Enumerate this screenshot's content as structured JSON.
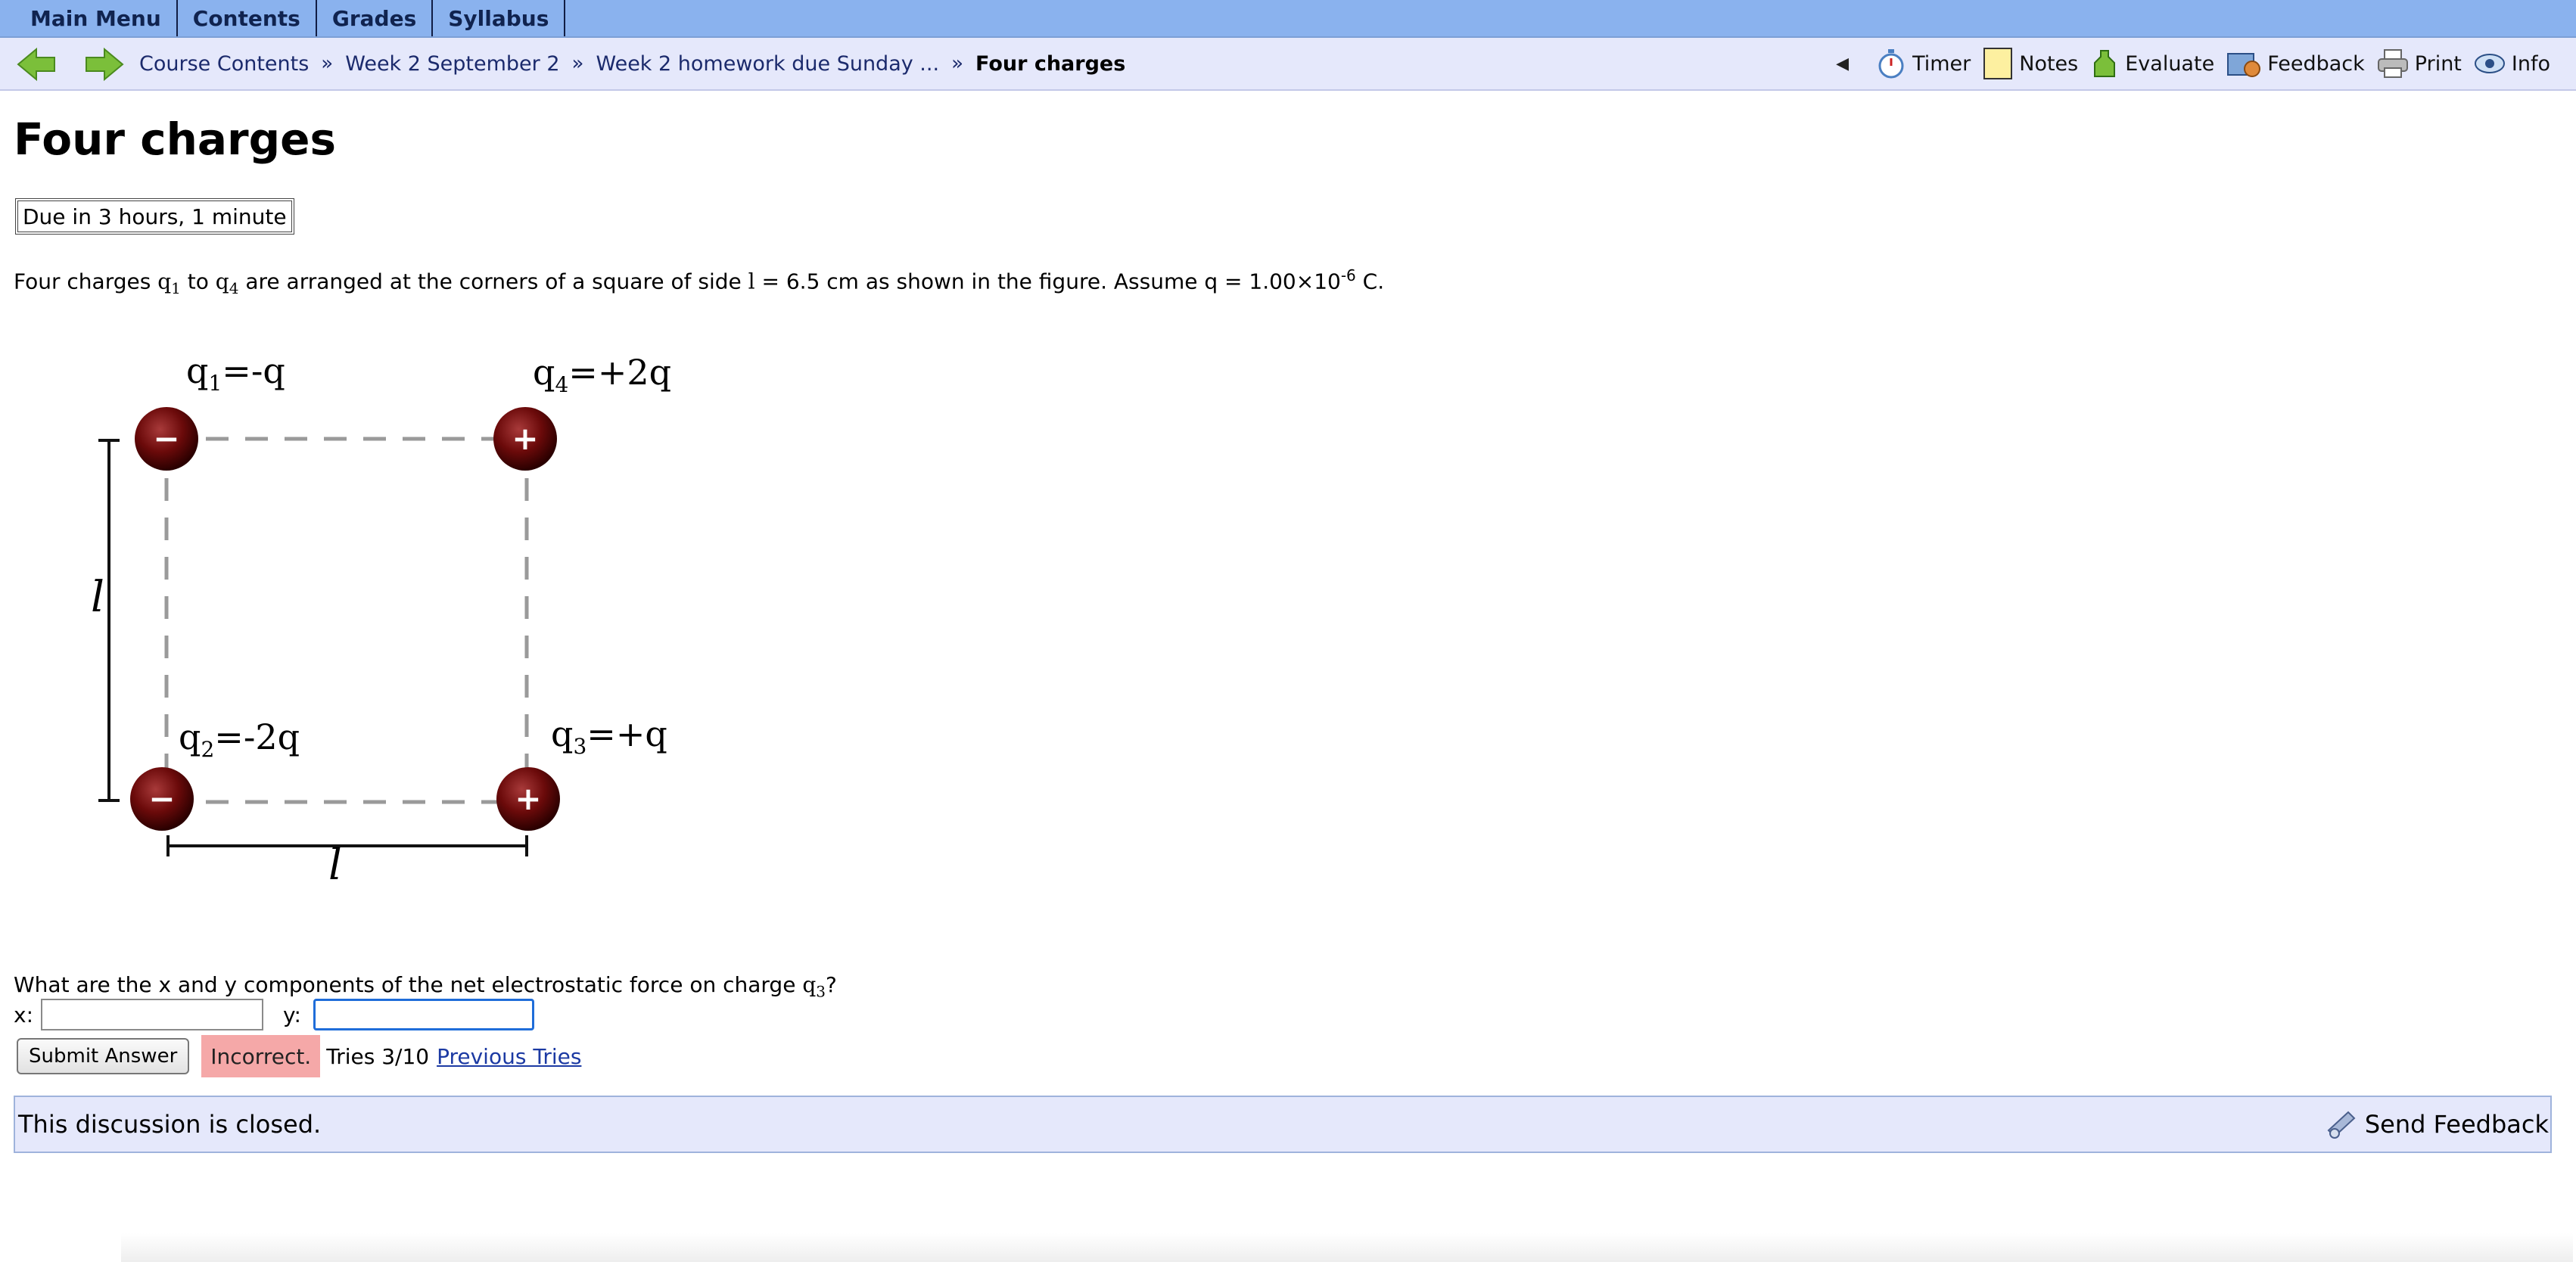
{
  "menu": {
    "tabs": [
      "Main Menu",
      "Contents",
      "Grades",
      "Syllabus"
    ]
  },
  "nav": {
    "breadcrumbs": [
      "Course Contents",
      "Week 2 September 2",
      "Week 2 homework due Sunday ..."
    ],
    "separator": "»",
    "current": "Four charges",
    "tools": {
      "collapse": "◀",
      "timer": "Timer",
      "notes": "Notes",
      "evaluate": "Evaluate",
      "feedback": "Feedback",
      "print": "Print",
      "info": "Info"
    }
  },
  "page": {
    "title": "Four charges",
    "due": "Due in 3 hours, 1 minute"
  },
  "problem": {
    "part1": "Four charges ",
    "q": "q",
    "sub1": "1",
    "to": " to ",
    "sub4": "4",
    "part2": " are arranged at the corners of a square of side ",
    "l": "l",
    "part3": " = 6.5 cm as shown in the figure. Assume q = 1.00×10",
    "exp": "-6",
    "part4": " C."
  },
  "figure": {
    "labels": {
      "q1": "q",
      "q1_sub": "1",
      "q1_val": "=-q",
      "q2": "q",
      "q2_sub": "2",
      "q2_val": "=-2q",
      "q3": "q",
      "q3_sub": "3",
      "q3_val": "=+q",
      "q4": "q",
      "q4_sub": "4",
      "q4_val": "=+2q"
    },
    "side_label_vertical": "l",
    "side_label_horizontal": "l",
    "signs": {
      "minus": "−",
      "plus": "+"
    }
  },
  "question": {
    "text": "What are the x and y components of the net electrostatic force on charge ",
    "q": "q",
    "sub": "3",
    "end": "?",
    "x_label": "x:",
    "y_label": "y:",
    "x_value": "",
    "y_value": ""
  },
  "submission": {
    "submit_label": "Submit Answer",
    "status": "Incorrect.",
    "tries": "Tries 3/10",
    "previous_tries": "Previous Tries"
  },
  "discussion": {
    "closed_text": "This discussion is closed.",
    "send_feedback": "Send Feedback"
  },
  "colors": {
    "menubar": "#8ab2ee",
    "navbar": "#e5e8fb",
    "incorrect": "#f5a8a8",
    "charge": "#6b0a0a"
  }
}
